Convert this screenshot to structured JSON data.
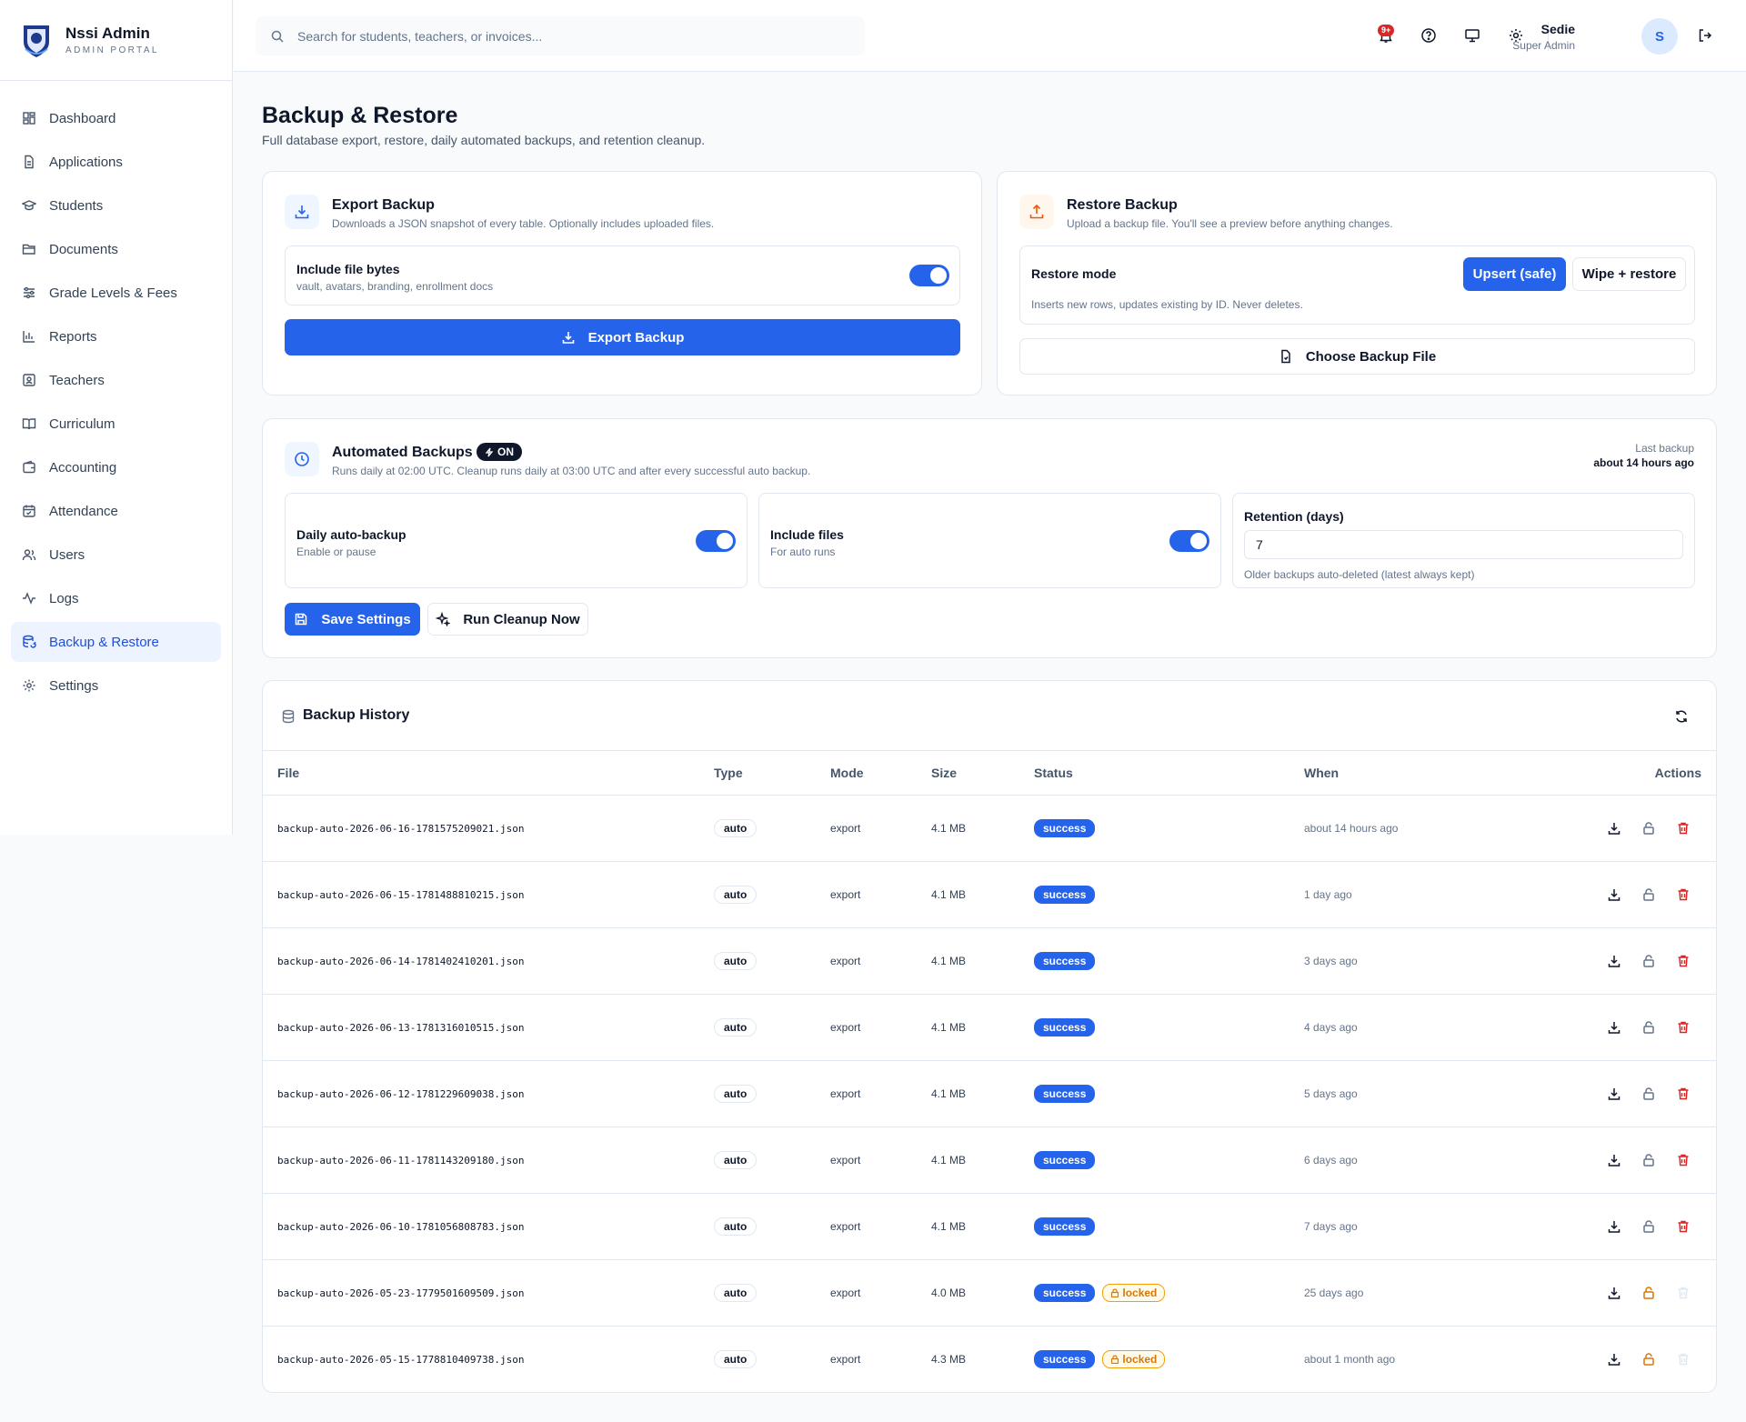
{
  "brand": {
    "title": "Nssi Admin",
    "subtitle": "ADMIN PORTAL"
  },
  "sidebar": {
    "items": [
      {
        "label": "Dashboard",
        "icon": "dashboard-icon"
      },
      {
        "label": "Applications",
        "icon": "document-icon"
      },
      {
        "label": "Students",
        "icon": "graduation-cap-icon"
      },
      {
        "label": "Documents",
        "icon": "folder-open-icon"
      },
      {
        "label": "Grade Levels & Fees",
        "icon": "sliders-icon"
      },
      {
        "label": "Reports",
        "icon": "bar-chart-icon"
      },
      {
        "label": "Teachers",
        "icon": "contact-icon"
      },
      {
        "label": "Curriculum",
        "icon": "book-open-icon"
      },
      {
        "label": "Accounting",
        "icon": "wallet-icon"
      },
      {
        "label": "Attendance",
        "icon": "calendar-check-icon"
      },
      {
        "label": "Users",
        "icon": "users-icon"
      },
      {
        "label": "Logs",
        "icon": "activity-icon"
      },
      {
        "label": "Backup & Restore",
        "icon": "database-backup-icon",
        "active": true
      },
      {
        "label": "Settings",
        "icon": "gear-icon"
      }
    ]
  },
  "topbar": {
    "search_placeholder": "Search for students, teachers, or invoices...",
    "notification_count": "9+",
    "user_name": "Sedie",
    "user_role": "Super Admin",
    "avatar_initial": "S"
  },
  "page": {
    "title": "Backup & Restore",
    "subtitle": "Full database export, restore, daily automated backups, and retention cleanup."
  },
  "export": {
    "title": "Export Backup",
    "subtitle": "Downloads a JSON snapshot of every table. Optionally includes uploaded files.",
    "include_label": "Include file bytes",
    "include_sub": "vault, avatars, branding, enrollment docs",
    "include_on": true,
    "button": "Export Backup"
  },
  "restore": {
    "title": "Restore Backup",
    "subtitle": "Upload a backup file. You'll see a preview before anything changes.",
    "mode_label": "Restore mode",
    "mode_upsert": "Upsert (safe)",
    "mode_wipe": "Wipe + restore",
    "mode_desc": "Inserts new rows, updates existing by ID. Never deletes.",
    "button": "Choose Backup File"
  },
  "auto": {
    "title": "Automated Backups",
    "status": "ON",
    "subtitle": "Runs daily at 02:00 UTC. Cleanup runs daily at 03:00 UTC and after every successful auto backup.",
    "last_label": "Last backup",
    "last_value": "about 14 hours ago",
    "daily_label": "Daily auto-backup",
    "daily_sub": "Enable or pause",
    "files_label": "Include files",
    "files_sub": "For auto runs",
    "retention_label": "Retention (days)",
    "retention_value": "7",
    "retention_sub": "Older backups auto-deleted (latest always kept)",
    "save_button": "Save Settings",
    "cleanup_button": "Run Cleanup Now"
  },
  "history": {
    "title": "Backup History",
    "columns": [
      "File",
      "Type",
      "Mode",
      "Size",
      "Status",
      "When",
      "Actions"
    ],
    "rows": [
      {
        "file": "backup-auto-2026-06-16-1781575209021.json",
        "type": "auto",
        "mode": "export",
        "size": "4.1 MB",
        "status": "success",
        "locked": false,
        "when": "about 14 hours ago"
      },
      {
        "file": "backup-auto-2026-06-15-1781488810215.json",
        "type": "auto",
        "mode": "export",
        "size": "4.1 MB",
        "status": "success",
        "locked": false,
        "when": "1 day ago"
      },
      {
        "file": "backup-auto-2026-06-14-1781402410201.json",
        "type": "auto",
        "mode": "export",
        "size": "4.1 MB",
        "status": "success",
        "locked": false,
        "when": "3 days ago"
      },
      {
        "file": "backup-auto-2026-06-13-1781316010515.json",
        "type": "auto",
        "mode": "export",
        "size": "4.1 MB",
        "status": "success",
        "locked": false,
        "when": "4 days ago"
      },
      {
        "file": "backup-auto-2026-06-12-1781229609038.json",
        "type": "auto",
        "mode": "export",
        "size": "4.1 MB",
        "status": "success",
        "locked": false,
        "when": "5 days ago"
      },
      {
        "file": "backup-auto-2026-06-11-1781143209180.json",
        "type": "auto",
        "mode": "export",
        "size": "4.1 MB",
        "status": "success",
        "locked": false,
        "when": "6 days ago"
      },
      {
        "file": "backup-auto-2026-06-10-1781056808783.json",
        "type": "auto",
        "mode": "export",
        "size": "4.1 MB",
        "status": "success",
        "locked": false,
        "when": "7 days ago"
      },
      {
        "file": "backup-auto-2026-05-23-1779501609509.json",
        "type": "auto",
        "mode": "export",
        "size": "4.0 MB",
        "status": "success",
        "locked": true,
        "locked_label": "locked",
        "when": "25 days ago"
      },
      {
        "file": "backup-auto-2026-05-15-1778810409738.json",
        "type": "auto",
        "mode": "export",
        "size": "4.3 MB",
        "status": "success",
        "locked": true,
        "locked_label": "locked",
        "when": "about 1 month ago"
      }
    ]
  },
  "colors": {
    "primary": "#2563eb",
    "danger": "#dc2626",
    "warning": "#d97706",
    "dark": "#0f172a"
  }
}
